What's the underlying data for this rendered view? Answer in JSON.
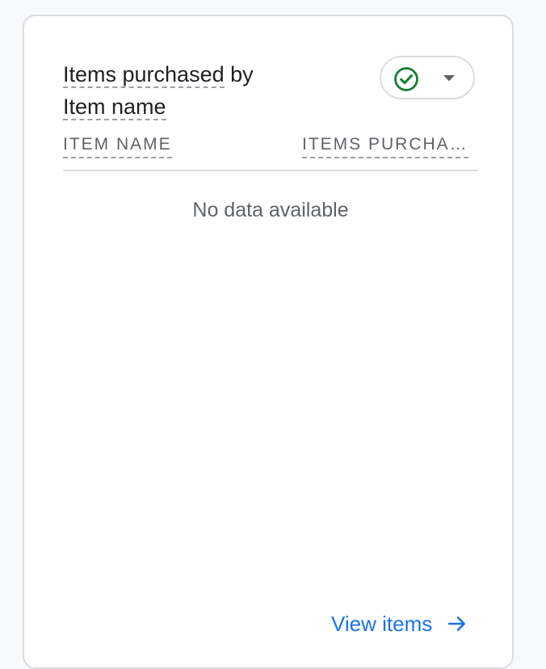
{
  "card": {
    "title_part1": "Items purchased",
    "title_part2": " by",
    "title_part3": "Item name",
    "status_icon": "check-circle-icon",
    "dropdown_icon": "caret-down-icon",
    "columns": [
      "ITEM NAME",
      "ITEMS PURCHA…"
    ],
    "empty_message": "No data available",
    "link_label": "View items",
    "link_icon": "arrow-right-icon"
  },
  "colors": {
    "accent": "#1a73e8",
    "success": "#188038",
    "text_primary": "#202124",
    "text_secondary": "#5f6368",
    "border": "#dadce0"
  }
}
